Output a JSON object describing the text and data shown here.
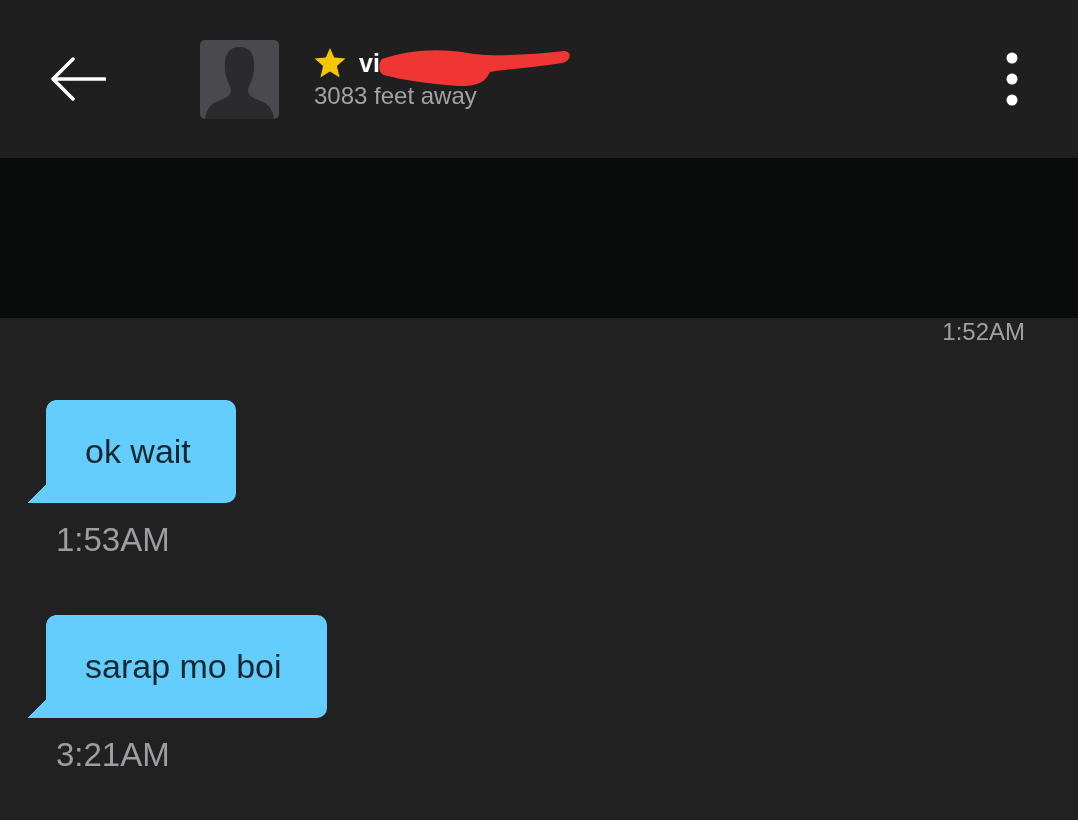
{
  "header": {
    "name": "vi",
    "favorite": true,
    "redacted": true,
    "distance": "3083 feet away"
  },
  "top_timestamp": "1:52AM",
  "messages": [
    {
      "text": "ok wait",
      "time": "1:53AM"
    },
    {
      "text": "sarap mo boi",
      "time": "3:21AM"
    }
  ]
}
